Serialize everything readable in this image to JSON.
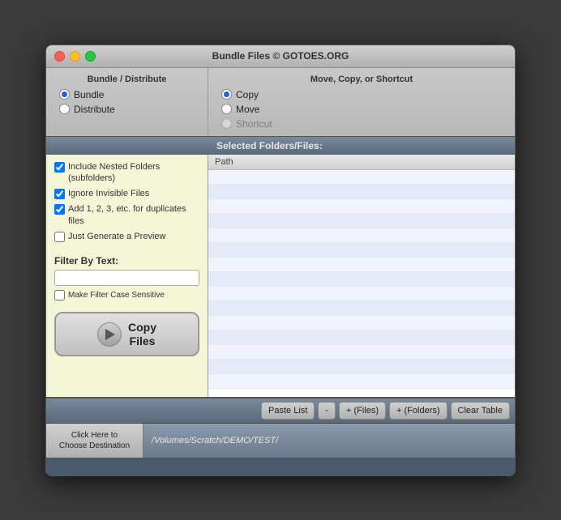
{
  "window": {
    "title": "Bundle Files © GOTOES.ORG"
  },
  "left_panel": {
    "title": "Bundle / Distribute",
    "options": [
      {
        "label": "Bundle",
        "selected": true
      },
      {
        "label": "Distribute",
        "selected": false
      }
    ]
  },
  "right_panel": {
    "title": "Move, Copy, or Shortcut",
    "options": [
      {
        "label": "Copy",
        "selected": true
      },
      {
        "label": "Move",
        "selected": false
      },
      {
        "label": "Shortcut",
        "selected": false,
        "disabled": true
      }
    ]
  },
  "selected_files": {
    "header": "Selected Folders/Files:",
    "column_path": "Path"
  },
  "options_panel": {
    "checkboxes": [
      {
        "label": "Include Nested Folders (subfolders)",
        "checked": true
      },
      {
        "label": "Ignore Invisible Files",
        "checked": true
      },
      {
        "label": "Add 1, 2, 3, etc. for duplicates files",
        "checked": true
      },
      {
        "label": "Just Generate a Preview",
        "checked": false
      }
    ]
  },
  "filter": {
    "label": "Filter By Text:",
    "placeholder": "",
    "case_sensitive_label": "Make Filter Case Sensitive"
  },
  "copy_button": {
    "line1": "Copy",
    "line2": "Files"
  },
  "toolbar": {
    "paste_list": "Paste List",
    "minus": "-",
    "plus_files": "+ (Files)",
    "plus_folders": "+ (Folders)",
    "clear_table": "Clear Table"
  },
  "footer": {
    "destination_btn_line1": "Click Here to",
    "destination_btn_line2": "Choose Destination",
    "path": "/Volumes/Scratch/DEMO/TEST/"
  },
  "table_rows": 15
}
